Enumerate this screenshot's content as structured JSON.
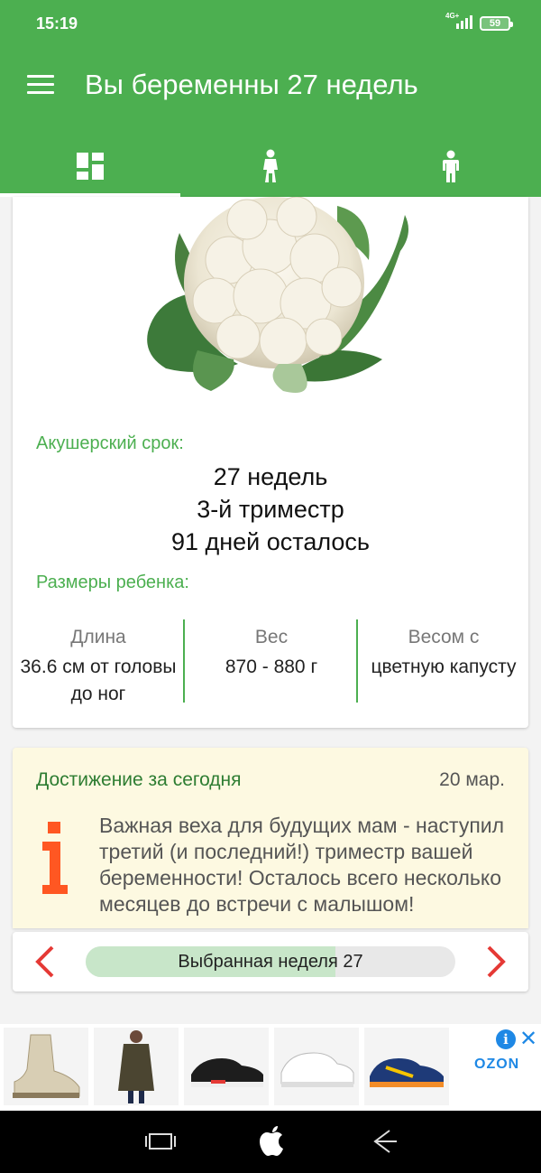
{
  "status_bar": {
    "time": "15:19",
    "network": "4G+",
    "battery": "59"
  },
  "app_bar": {
    "title": "Вы беременны 27 недель",
    "tabs": [
      {
        "icon": "dashboard-icon",
        "selected": true
      },
      {
        "icon": "pregnant-woman-icon",
        "selected": false
      },
      {
        "icon": "child-icon",
        "selected": false
      }
    ]
  },
  "week_card": {
    "image": "cauliflower-image",
    "obstetric_label": "Акушерский срок:",
    "term_lines": [
      "27 недель",
      "3-й триместр",
      "91 дней осталось"
    ],
    "sizes_label": "Размеры ребенка:",
    "metrics": [
      {
        "header": "Длина",
        "value": "36.6 см от головы до ног"
      },
      {
        "header": "Вес",
        "value": "870 - 880 г"
      },
      {
        "header": "Весом с",
        "value": "цветную капусту"
      }
    ]
  },
  "achievement": {
    "title": "Достижение за сегодня",
    "date": "20 мар.",
    "icon": "info-icon",
    "text": "Важная веха для будущих мам - наступил третий (и последний!) триместр вашей беременности! Осталось всего несколько месяцев до встречи с малышом!"
  },
  "week_selector": {
    "label": "Выбранная неделя 27",
    "progress": 0.675
  },
  "ad_banner": {
    "brand": "OZON",
    "info": "i",
    "close": "✕",
    "items": [
      "boots-image",
      "coat-image",
      "sneakers-black-image",
      "sneakers-white-image",
      "running-shoe-image"
    ]
  },
  "colors": {
    "primary": "#4caf50",
    "achievement_bg": "#fdf9e1",
    "arrow": "#e53935",
    "info_orange": "#ff5722"
  }
}
